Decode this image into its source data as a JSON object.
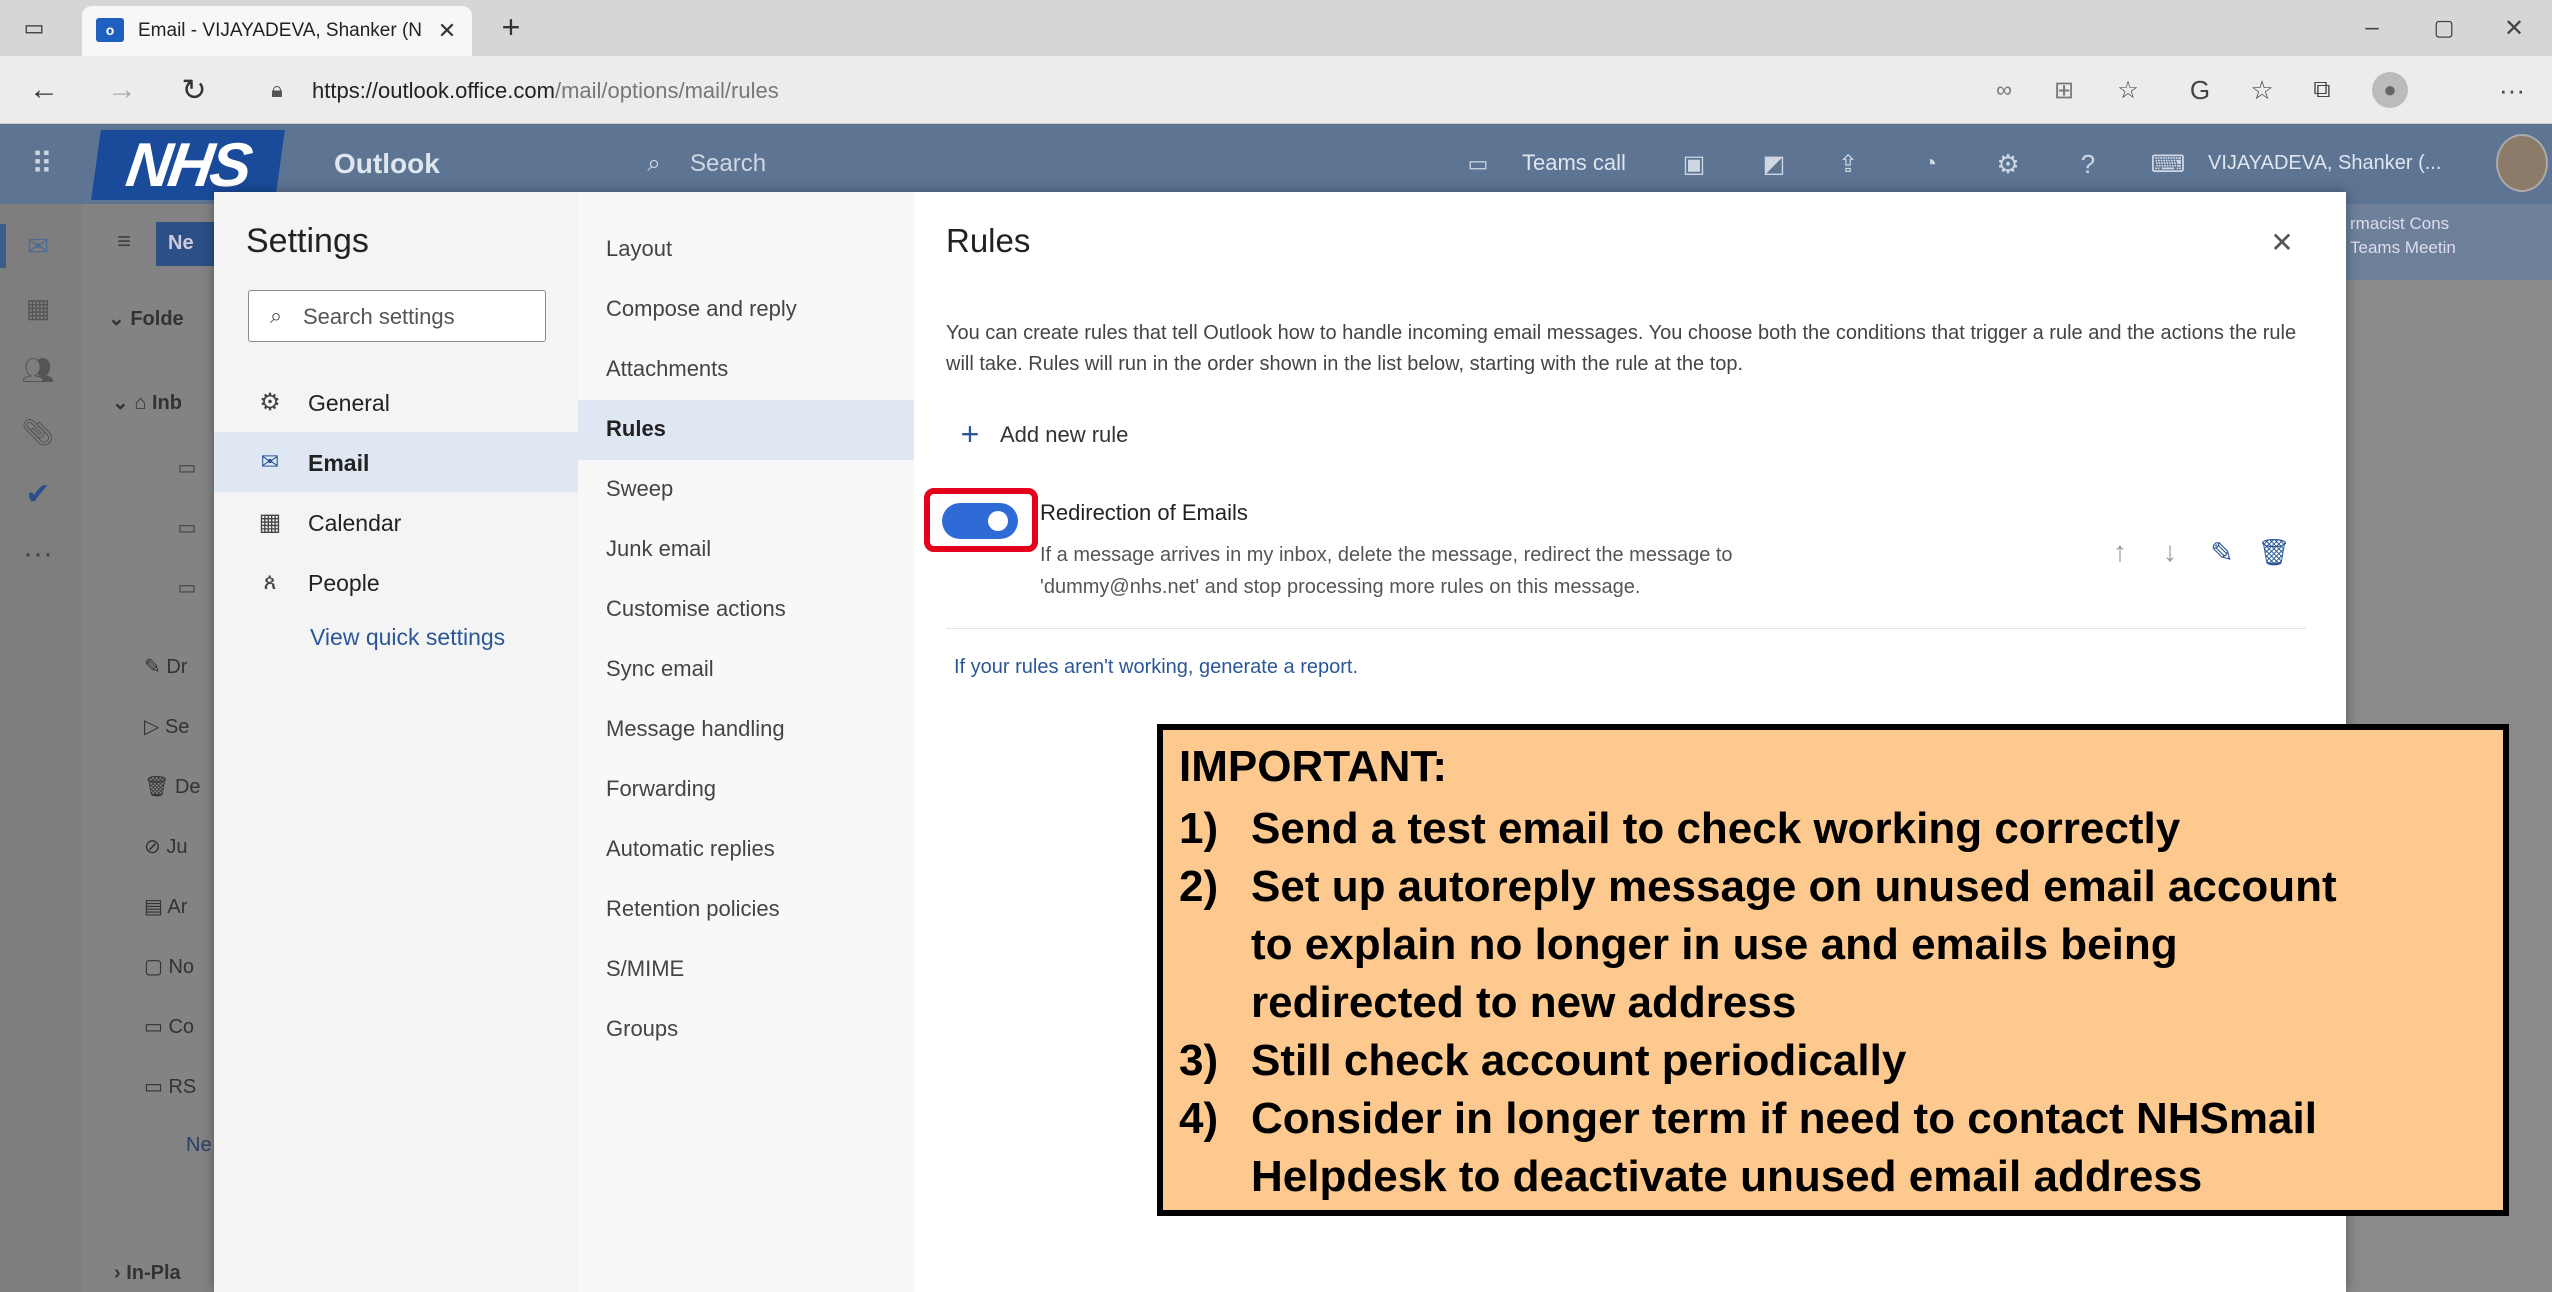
{
  "browser": {
    "tab_title": "Email - VIJAYADEVA, Shanker (N",
    "url_host": "https://outlook.office.com",
    "url_path": "/mail/options/mail/rules"
  },
  "outlook": {
    "brand": "NHS",
    "app_name": "Outlook",
    "search_placeholder": "Search",
    "teams_call": "Teams call",
    "user_name": "VIJAYADEVA, Shanker (...",
    "new_button": "Ne",
    "folder_header": "Folde",
    "folders": [
      "Inb",
      "",
      "",
      "",
      "Dr",
      "Se",
      "De",
      "Ju",
      "Ar",
      "No",
      "Co",
      "RS",
      "Ne",
      "In-Pla"
    ],
    "right_peek": [
      "rmacist Cons",
      "Teams Meetin"
    ]
  },
  "settings": {
    "title": "Settings",
    "search_placeholder": "Search settings",
    "categories": [
      {
        "label": "General",
        "icon": "gear-icon"
      },
      {
        "label": "Email",
        "icon": "mail-icon"
      },
      {
        "label": "Calendar",
        "icon": "calendar-icon"
      },
      {
        "label": "People",
        "icon": "people-icon"
      }
    ],
    "view_quick_settings": "View quick settings",
    "subnav": [
      "Layout",
      "Compose and reply",
      "Attachments",
      "Rules",
      "Sweep",
      "Junk email",
      "Customise actions",
      "Sync email",
      "Message handling",
      "Forwarding",
      "Automatic replies",
      "Retention policies",
      "S/MIME",
      "Groups"
    ]
  },
  "rules": {
    "title": "Rules",
    "description": "You can create rules that tell Outlook how to handle incoming email messages. You choose both the conditions that trigger a rule and the actions the rule will take. Rules will run in the order shown in the list below, starting with the rule at the top.",
    "add_new_rule": "Add new rule",
    "rule_name": "Redirection of Emails",
    "rule_desc_line1": "If a message arrives in my inbox, delete the message, redirect the message to",
    "rule_desc_line2": "'dummy@nhs.net' and stop processing more rules on this message.",
    "rule_enabled": true,
    "report_link": "If your rules aren't working, generate a report."
  },
  "callout": {
    "heading": "IMPORTANT:",
    "items": [
      {
        "num": "1)",
        "lines": [
          "Send a test email to check working correctly"
        ]
      },
      {
        "num": "2)",
        "lines": [
          "Set up autoreply message on unused email account",
          "to explain no longer in use and emails being",
          "redirected to new address"
        ]
      },
      {
        "num": "3)",
        "lines": [
          "Still check account periodically"
        ]
      },
      {
        "num": "4)",
        "lines": [
          "Consider in longer term if need to contact NHSmail",
          "Helpdesk to deactivate unused email address"
        ]
      }
    ],
    "bg_color": "#fdc98e",
    "toggle_color": "#2f6bd6",
    "highlight_color": "#e4001b"
  }
}
